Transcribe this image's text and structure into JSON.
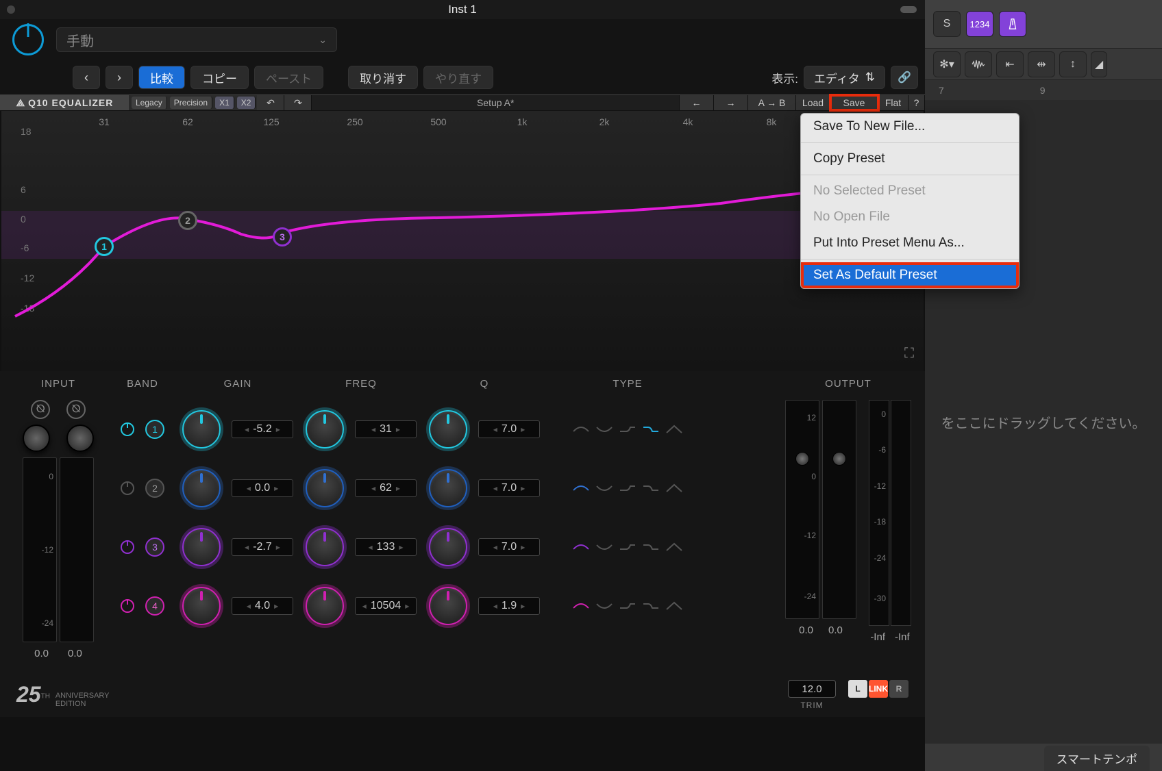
{
  "window": {
    "title": "Inst 1"
  },
  "host": {
    "preset_selected": "手動",
    "nav_prev": "‹",
    "nav_next": "›",
    "compare": "比較",
    "copy": "コピー",
    "paste": "ペースト",
    "undo": "取り消す",
    "redo": "やり直す",
    "view_label": "表示:",
    "view_value": "エディタ"
  },
  "waves_toolbar": {
    "plugin_name": "Q10 Equalizer",
    "legacy": "Legacy",
    "precision": "Precision",
    "x1": "X1",
    "x2": "X2",
    "undo": "↶",
    "redo": "↷",
    "setup": "Setup A*",
    "prev": "←",
    "next": "→",
    "ab": "A → B",
    "load": "Load",
    "save": "Save",
    "flat": "Flat",
    "help": "?"
  },
  "graph": {
    "y_ticks": [
      "18",
      "6",
      "0",
      "-6",
      "-12",
      "-18"
    ],
    "x_ticks": [
      "31",
      "62",
      "125",
      "250",
      "500",
      "1k",
      "2k",
      "4k",
      "8k"
    ]
  },
  "column_labels": {
    "input": "INPUT",
    "band": "BAND",
    "gain": "GAIN",
    "freq": "FREQ",
    "q": "Q",
    "type": "TYPE",
    "output": "OUTPUT"
  },
  "bands": [
    {
      "n": "1",
      "on": true,
      "cls": "c1",
      "gain": "-5.2",
      "freq": "31",
      "q": "7.0"
    },
    {
      "n": "2",
      "on": false,
      "cls": "c2",
      "gain": "0.0",
      "freq": "62",
      "q": "7.0"
    },
    {
      "n": "3",
      "on": true,
      "cls": "c3",
      "gain": "-2.7",
      "freq": "133",
      "q": "7.0"
    },
    {
      "n": "4",
      "on": true,
      "cls": "c4",
      "gain": "4.0",
      "freq": "10504",
      "q": "1.9"
    }
  ],
  "input": {
    "val_l": "0.0",
    "val_r": "0.0",
    "scale": [
      "0",
      "-12",
      "-24"
    ]
  },
  "output": {
    "fader_l": "0.0",
    "fader_r": "0.0",
    "meter_l": "-Inf",
    "meter_r": "-Inf",
    "fader_scale": [
      "12",
      "0",
      "-12",
      "-24"
    ],
    "meter_scale": [
      "0",
      "-6",
      "-12",
      "-18",
      "-24",
      "-30"
    ]
  },
  "trim": {
    "value": "12.0",
    "label": "TRIM",
    "L": "L",
    "link": "LINK",
    "R": "R"
  },
  "anniversary": {
    "big": "25",
    "sub": "ANNIVERSARY\nEDITION",
    "th": "TH"
  },
  "save_menu": {
    "save_new": "Save To New File...",
    "copy_preset": "Copy Preset",
    "no_selected": "No Selected Preset",
    "no_open": "No Open File",
    "put_into": "Put Into Preset Menu As...",
    "set_default": "Set As Default Preset"
  },
  "daw": {
    "s": "S",
    "count": "1234",
    "ruler": [
      "7",
      "9"
    ],
    "drag_hint": "をここにドラッグしてください。",
    "smart_tempo": "スマートテンポ"
  }
}
